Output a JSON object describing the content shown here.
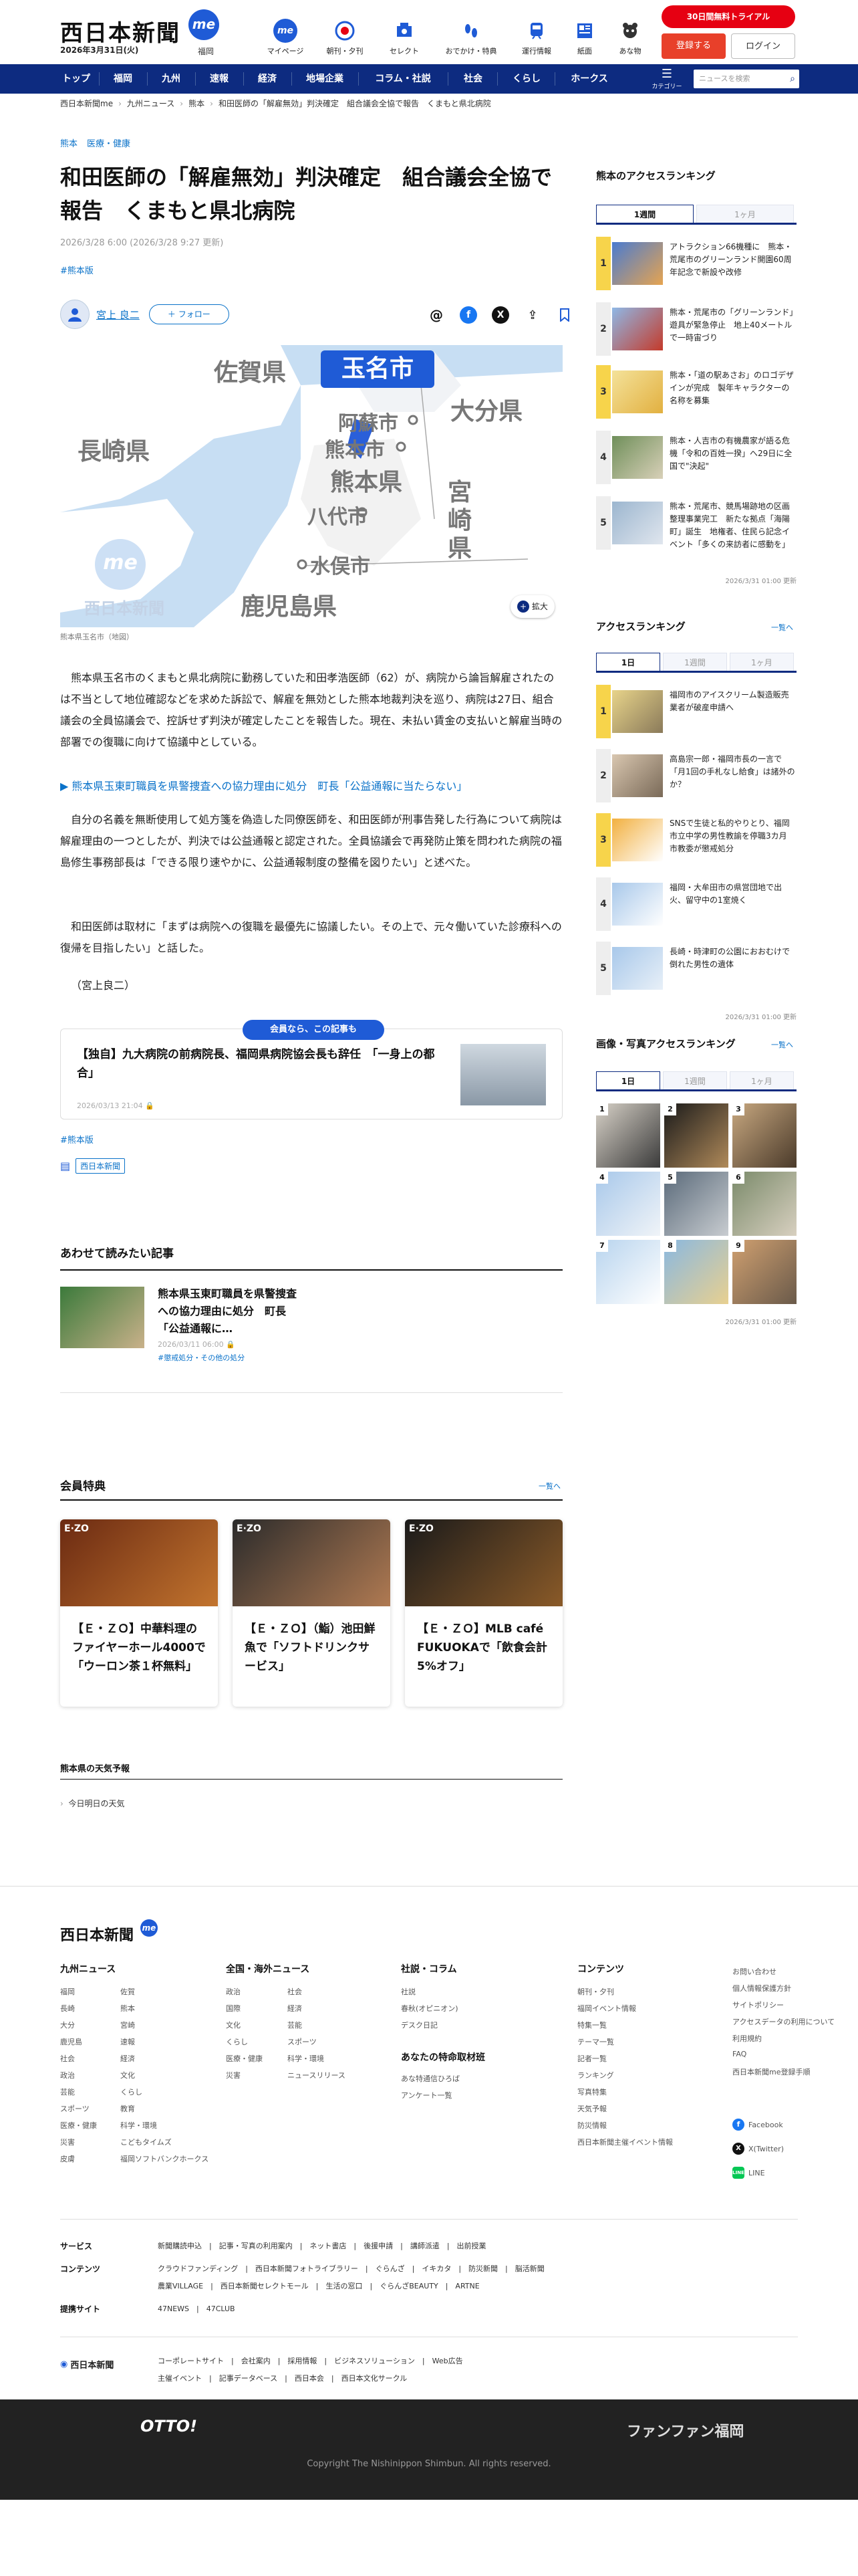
{
  "header": {
    "logo": "西日本新聞",
    "me_badge": "me",
    "area": "福岡",
    "date": "2026年3月31日(火)",
    "nav": [
      {
        "label": "マイページ",
        "icon": "me-icon"
      },
      {
        "label": "朝刊・夕刊",
        "icon": "newspaper-icon"
      },
      {
        "label": "セレクト",
        "icon": "select-icon"
      },
      {
        "label": "おでかけ・特典",
        "icon": "footprint-icon"
      },
      {
        "label": "運行情報",
        "icon": "train-icon"
      },
      {
        "label": "紙面",
        "icon": "paper-icon"
      },
      {
        "label": "あな物",
        "icon": "animal-icon"
      }
    ],
    "trial": "30日間無料トライアル",
    "register": "登録する",
    "login": "ログイン"
  },
  "bluenav": {
    "items": [
      "トップ",
      "福岡",
      "九州",
      "速報",
      "経済",
      "地場企業",
      "コラム・社説",
      "社会",
      "くらし",
      "ホークス"
    ],
    "category": "カテゴリー",
    "search_placeholder": "ニュースを検索"
  },
  "breadcrumb": [
    "西日本新聞me",
    "九州ニュース",
    "熊本",
    "和田医師の「解雇無効」判決確定　組合議会全協で報告　くまもと県北病院"
  ],
  "article": {
    "tags": [
      "熊本",
      "医療・健康"
    ],
    "title": "和田医師の「解雇無効」判決確定　組合議会全協で報告　くまもと県北病院",
    "date": "2026/3/28 6:00 (2026/3/28 9:27 更新)",
    "hashtag": "#熊本版",
    "author": "宮上 良二",
    "follow": "フォロー",
    "map_caption": "熊本県玉名市（地図）",
    "map_labels": {
      "target": "玉名市",
      "saga": "佐賀県",
      "nagasaki": "長崎県",
      "oita": "大分県",
      "kumamoto": "熊本県",
      "miyazaki": "宮崎県",
      "kagoshima": "鹿児島県",
      "aso": "阿蘇市",
      "kumamoto_city": "熊本市",
      "yatsushiro": "八代市",
      "minamata": "水俣市"
    },
    "zoom": "拡大",
    "p1": "熊本県玉名市のくまもと県北病院に勤務していた和田孝浩医師（62）が、病院から論旨解雇されたのは不当として地位確認などを求めた訴訟で、解雇を無効とした熊本地裁判決を巡り、病院は27日、組合議会の全員協議会で、控訴せず判決が確定したことを報告した。現在、未払い賃金の支払いと解雇当時の部署での復職に向けて協議中としている。",
    "related_link": "熊本県玉東町職員を県警捜査への協力理由に処分　町長「公益通報に当たらない」",
    "p2": "自分の名義を無断使用して処方箋を偽造した同僚医師を、和田医師が刑事告発した行為について病院は解雇理由の一つとしたが、判決では公益通報と認定された。全員協議会で再発防止策を問われた病院の福島修生事務部長は「できる限り速やかに、公益通報制度の整備を図りたい」と述べた。",
    "p3": "和田医師は取材に「まずは病院への復職を最優先に協議したい。その上で、元々働いていた診療科への復帰を目指したい」と話した。",
    "signature": "（宮上良二）",
    "member_tag": "会員なら、この記事も",
    "member_title": "【独自】九大病院の前病院長、福岡県病院協会長も辞任　「一身上の都合」",
    "member_date": "2026/03/13 21:04",
    "hashtag2": "#熊本版",
    "source": "西日本新聞"
  },
  "related": {
    "heading": "あわせて読みたい記事",
    "title": "熊本県玉東町職員を県警捜査への協力理由に処分　町長「公益通報に…",
    "date": "2026/03/11 06:00",
    "tag": "#懲戒処分・その他の処分"
  },
  "benefits": {
    "heading": "会員特典",
    "more": "一覧へ",
    "cards": [
      {
        "title": "【Ｅ・ＺＯ】中華料理のファイヤーホール4000で「ウーロン茶１杯無料」"
      },
      {
        "title": "【Ｅ・ＺＯ】（鮨）池田鮮魚で「ソフトドリンクサービス」"
      },
      {
        "title": "【Ｅ・ＺＯ】MLB café FUKUOKAで「飲食会計5%オフ」"
      }
    ],
    "card_label": "E·ZO"
  },
  "weather": {
    "heading": "熊本県の天気予報",
    "today": "今日明日の天気"
  },
  "sidebar": {
    "access1_heading": "熊本のアクセスランキング",
    "access1_tabs": [
      "1週間",
      "1ヶ月"
    ],
    "access1": [
      "アトラクション66機種に　熊本・荒尾市のグリーンランド開園60周年記念で新設や改修",
      "熊本・荒尾市の「グリーンランド」遊具が緊急停止　地上40メートルで一時宙づり",
      "熊本・「道の駅あさお」のロゴデザインが完成　製年キャラクターの名称を募集",
      "熊本・人吉市の有機農家が語る危機「令和の百姓一揆」へ29日に全国で\"決起\"",
      "熊本・荒尾市、競馬場跡地の区画整理事業完工　新たな拠点「海陽町」誕生　地権者、住民ら記念イベント「多くの来訪者に感動を」"
    ],
    "access1_updated": "2026/3/31 01:00 更新",
    "access2_heading": "アクセスランキング",
    "access2_more": "一覧へ",
    "access2_tabs": [
      "1日",
      "1週間",
      "1ヶ月"
    ],
    "access2": [
      "福岡市のアイスクリーム製造販売業者が破産申請へ",
      "高島宗一郎・福岡市長の一言で「月1回の手札なし給食」は諸外のか？",
      "SNSで生徒と私的やりとり、福岡市立中学の男性教諭を停職3カ月　市教委が懲戒処分",
      "福岡・大牟田市の県営団地で出火、留守中の1室焼く",
      "長崎・時津町の公園におおむけで倒れた男性の遺体"
    ],
    "access2_updated": "2026/3/31 01:00 更新",
    "photo_heading": "画像・写真アクセスランキング",
    "photo_more": "一覧へ",
    "photo_tabs": [
      "1日",
      "1週間",
      "1ヶ月"
    ],
    "photo_nums": [
      "1",
      "2",
      "3",
      "4",
      "5",
      "6",
      "7",
      "8",
      "9"
    ],
    "photo_updated": "2026/3/31 01:00 更新"
  },
  "footer": {
    "logo": "西日本新聞",
    "col1_heading": "九州ニュース",
    "col1a": [
      "福岡",
      "長崎",
      "大分",
      "鹿児島",
      "社会",
      "政治",
      "芸能",
      "スポーツ",
      "医療・健康",
      "災害",
      "皮膚"
    ],
    "col1b": [
      "佐賀",
      "熊本",
      "宮崎",
      "速報",
      "経済",
      "文化",
      "くらし",
      "教育",
      "科学・環境",
      "こどもタイムズ",
      "福岡ソフトバンクホークス"
    ],
    "col2_heading": "全国・海外ニュース",
    "col2a": [
      "政治",
      "国際",
      "文化",
      "くらし",
      "医療・健康",
      "災害"
    ],
    "col2b": [
      "社会",
      "経済",
      "芸能",
      "スポーツ",
      "科学・環境",
      "ニュースリリース"
    ],
    "col3_heading": "社説・コラム",
    "col3": [
      "社説",
      "春秋(オピニオン)",
      "デスク日記"
    ],
    "col3b_heading": "あなたの特命取材班",
    "col3b": [
      "あな特通信ひろば",
      "アンケート一覧"
    ],
    "col4_heading": "コンテンツ",
    "col4": [
      "朝刊・夕刊",
      "福岡イベント情報",
      "特集一覧",
      "テーマ一覧",
      "記者一覧",
      "ランキング",
      "写真特集",
      "天気予報",
      "防災情報",
      "西日本新聞主催イベント情報"
    ],
    "col5": [
      "お問い合わせ",
      "個人情報保護方針",
      "サイトポリシー",
      "アクセスデータの利用について",
      "利用規約",
      "FAQ",
      "西日本新聞me登録手順"
    ],
    "social": [
      "Facebook",
      "X(Twitter)",
      "LINE"
    ],
    "svc_label": "サービス",
    "svc": "新聞購読申込　|　記事・写真の利用案内　|　ネット書店　|　後援申請　|　講師派遣　|　出前授業",
    "cnt_label": "コンテンツ",
    "cnt1": "クラウドファンディング　|　西日本新聞フォトライブラリー　|　ぐらんざ　|　イキカタ　|　防災新聞　|　脳活新聞",
    "cnt2": "農業VILLAGE　|　西日本新聞セレクトモール　|　生活の窓口　|　ぐらんざBEAUTY　|　ARTNE",
    "site_label": "提携サイト",
    "site": "47NEWS　|　47CLUB",
    "corp_logo": "西日本新聞",
    "corp1": "コーポレートサイト　|　会社案内　|　採用情報　|　ビジネスソリューション　|　Web広告",
    "corp2": "主催イベント　|　記事データベース　|　西日本会　|　西日本文化サークル",
    "otto": "OTTO!",
    "funfun": "ファンファン福岡",
    "copyright": "Copyright The Nishinippon Shimbun. All rights reserved."
  }
}
